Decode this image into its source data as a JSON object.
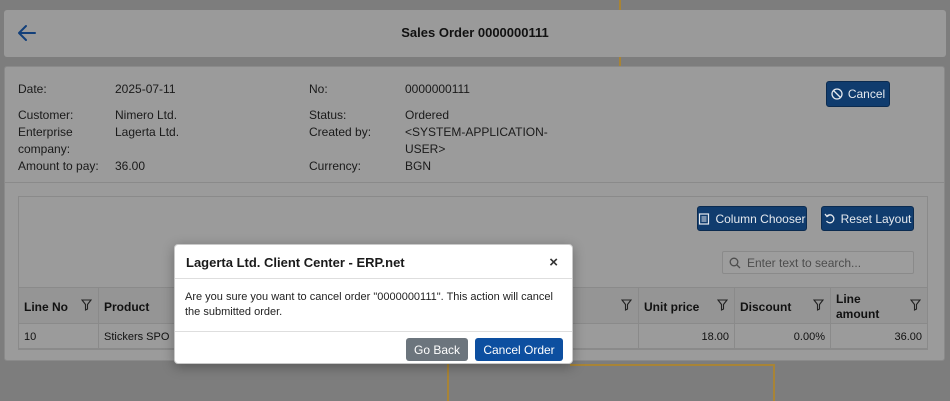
{
  "header": {
    "title": "Sales Order 0000000111"
  },
  "order": {
    "date_label": "Date:",
    "date": "2025-07-11",
    "no_label": "No:",
    "no": "0000000111",
    "customer_label": "Customer:",
    "customer": "Nimero Ltd.",
    "status_label": "Status:",
    "status": "Ordered",
    "enterprise_label_1": "Enterprise",
    "enterprise_label_2": "company:",
    "enterprise": "Lagerta Ltd.",
    "created_by_label": "Created by:",
    "created_by_1": "<SYSTEM-APPLICATION-",
    "created_by_2": "USER>",
    "amount_label": "Amount to pay:",
    "amount": "36.00",
    "currency_label": "Currency:",
    "currency": "BGN"
  },
  "actions": {
    "cancel": "Cancel"
  },
  "grid": {
    "column_chooser": "Column Chooser",
    "reset_layout": "Reset Layout",
    "search_placeholder": "Enter text to search...",
    "columns": {
      "line_no": "Line No",
      "product": "Product",
      "unit_price": "Unit price",
      "discount": "Discount",
      "line_amount_1": "Line",
      "line_amount_2": "amount"
    },
    "rows": [
      {
        "line_no": "10",
        "product": "Stickers SPO",
        "unit_price": "18.00",
        "discount": "0.00%",
        "line_amount": "36.00"
      }
    ]
  },
  "modal": {
    "title": "Lagerta Ltd. Client Center - ERP.net",
    "close": "×",
    "message": "Are you sure you want to cancel order \"0000000111\". This action will cancel the submitted order.",
    "go_back": "Go Back",
    "cancel_order": "Cancel Order"
  },
  "colors": {
    "overlay_bg": "#7d7d7d",
    "button_dark": "#103c6e",
    "primary": "#0d4fa0",
    "secondary": "#6c757d",
    "background_line": "#a88436"
  },
  "icons": {
    "back": "arrow-left-icon",
    "cancel": "ban-icon",
    "column_chooser": "columns-icon",
    "reset_layout": "undo-icon",
    "search": "search-icon",
    "filter": "filter-icon"
  }
}
